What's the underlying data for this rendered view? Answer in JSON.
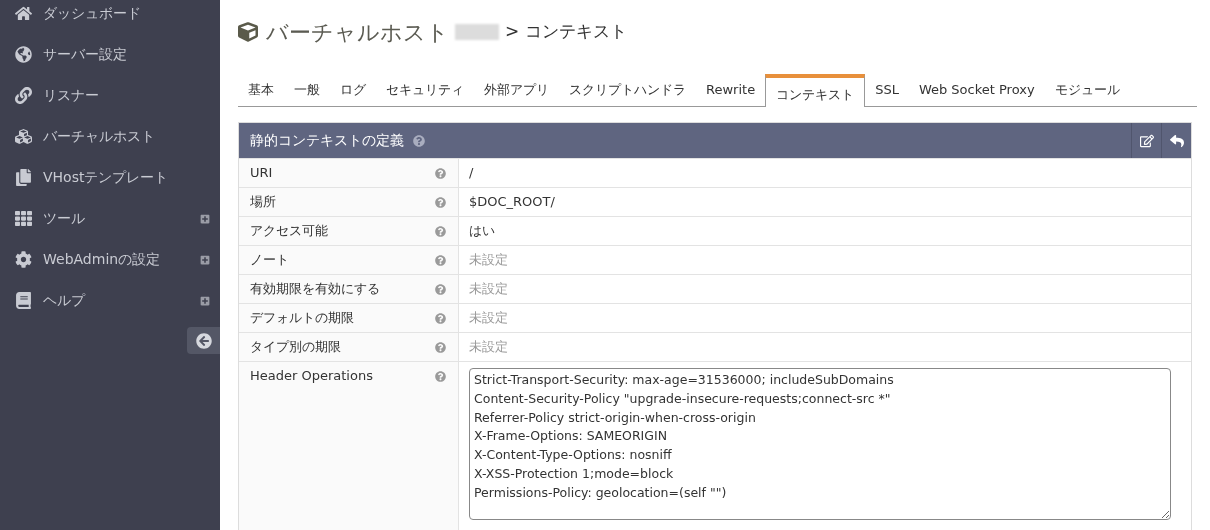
{
  "sidebar": {
    "items": [
      {
        "label": "ダッシュボード",
        "expandable": false
      },
      {
        "label": "サーバー設定",
        "expandable": false
      },
      {
        "label": "リスナー",
        "expandable": false
      },
      {
        "label": "バーチャルホスト",
        "expandable": false
      },
      {
        "label": "VHostテンプレート",
        "expandable": false
      },
      {
        "label": "ツール",
        "expandable": true
      },
      {
        "label": "WebAdminの設定",
        "expandable": true
      },
      {
        "label": "ヘルプ",
        "expandable": true
      }
    ]
  },
  "title": {
    "main": "バーチャルホスト",
    "sub": "> コンテキスト"
  },
  "tabs": [
    {
      "label": "基本",
      "selected": false
    },
    {
      "label": "一般",
      "selected": false
    },
    {
      "label": "ログ",
      "selected": false
    },
    {
      "label": "セキュリティ",
      "selected": false
    },
    {
      "label": "外部アプリ",
      "selected": false
    },
    {
      "label": "スクリプトハンドラ",
      "selected": false
    },
    {
      "label": "Rewrite",
      "selected": false
    },
    {
      "label": "コンテキスト",
      "selected": true
    },
    {
      "label": "SSL",
      "selected": false
    },
    {
      "label": "Web Socket Proxy",
      "selected": false
    },
    {
      "label": "モジュール",
      "selected": false
    }
  ],
  "panel": {
    "title": "静的コンテキストの定義",
    "rows": [
      {
        "label": "URI",
        "kind": "text",
        "value": "/"
      },
      {
        "label": "場所",
        "kind": "text",
        "value": "$DOC_ROOT/"
      },
      {
        "label": "アクセス可能",
        "kind": "text",
        "value": "はい"
      },
      {
        "label": "ノート",
        "kind": "unset",
        "value": "未設定"
      },
      {
        "label": "有効期限を有効にする",
        "kind": "unset",
        "value": "未設定"
      },
      {
        "label": "デフォルトの期限",
        "kind": "unset",
        "value": "未設定"
      },
      {
        "label": "タイプ別の期限",
        "kind": "unset",
        "value": "未設定"
      },
      {
        "label": "Header Operations",
        "kind": "textarea",
        "lines": [
          "Strict-Transport-Security: max-age=31536000; includeSubDomains",
          "Content-Security-Policy \"upgrade-insecure-requests;connect-src *\"",
          "Referrer-Policy strict-origin-when-cross-origin",
          "X-Frame-Options: SAMEORIGIN",
          "X-Content-Type-Options: nosniff",
          "X-XSS-Protection 1;mode=block",
          "Permissions-Policy: geolocation=(self \"\")"
        ]
      }
    ]
  }
}
